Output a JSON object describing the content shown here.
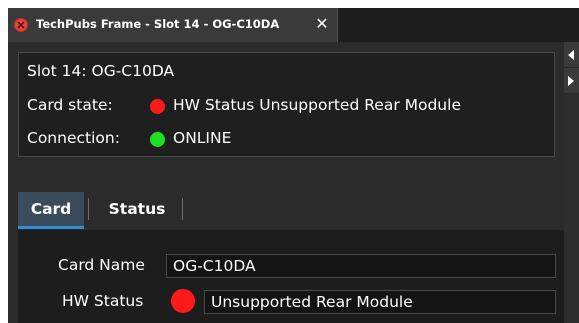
{
  "window": {
    "tab_title": "TechPubs Frame - Slot 14 - OG-C10DA",
    "close_glyph": "✕"
  },
  "icons": {
    "tab_close": "close-circle-icon",
    "arrow_left": "arrow-left-icon",
    "arrow_right": "arrow-right-icon"
  },
  "info": {
    "slot": "Slot 14: OG-C10DA",
    "card_state_label": "Card state:",
    "card_state_value": "HW Status Unsupported Rear Module",
    "connection_label": "Connection:",
    "connection_value": "ONLINE"
  },
  "tabs": [
    {
      "label": "Card"
    },
    {
      "label": "Status"
    }
  ],
  "fields": {
    "card_name_label": "Card Name",
    "card_name_value": "OG-C10DA",
    "hw_status_label": "HW Status",
    "hw_status_value": "Unsupported Rear Module"
  },
  "colors": {
    "status_error": "#ff1a1a",
    "status_ok": "#1ee01e",
    "tab_accent": "#2e8fd6"
  }
}
